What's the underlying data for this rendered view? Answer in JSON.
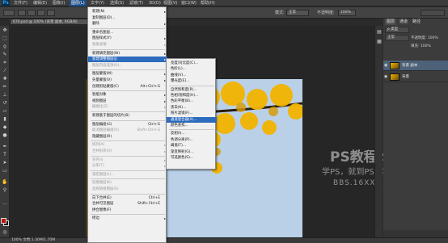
{
  "menubar": {
    "logo": "Ps",
    "items": [
      "文件(F)",
      "编辑(E)",
      "图像(I)",
      "图层(L)",
      "文字(Y)",
      "选择(S)",
      "滤镜(T)",
      "3D(D)",
      "视图(V)",
      "窗口(W)",
      "帮助(H)"
    ],
    "active_index": 3
  },
  "doc_tab": {
    "title": "670.psd @ 100% (背景 副本, RGB/8)"
  },
  "options": {
    "mode_label": "模式:",
    "mode_value": "正常",
    "opacity_label": "不透明度:",
    "opacity_value": "100%"
  },
  "status": {
    "text": "100%   文档:1.30M/1.70M"
  },
  "layer_menu": {
    "items": [
      {
        "label": "新建(N)",
        "arrow": true
      },
      {
        "label": "复制图层(D)...",
        "arrow": false
      },
      {
        "label": "删除",
        "arrow": true
      },
      {
        "sep": true
      },
      {
        "label": "重命名图层...",
        "arrow": false
      },
      {
        "label": "图层样式(Y)",
        "arrow": true
      },
      {
        "label": "智能滤镜",
        "arrow": true,
        "disabled": true
      },
      {
        "sep": true
      },
      {
        "label": "新建填充图层(W)",
        "arrow": true
      },
      {
        "label": "新建调整图层(J)",
        "arrow": true,
        "highlight": true
      },
      {
        "label": "图层内容选项(O)...",
        "disabled": true
      },
      {
        "sep": true
      },
      {
        "label": "图层蒙版(M)",
        "arrow": true
      },
      {
        "label": "矢量蒙版(V)",
        "arrow": true
      },
      {
        "label": "创建剪贴蒙版(C)",
        "shortcut": "Alt+Ctrl+G"
      },
      {
        "sep": true
      },
      {
        "label": "智能对象",
        "arrow": true
      },
      {
        "label": "视频图层",
        "arrow": true
      },
      {
        "label": "栅格化(Z)",
        "arrow": true,
        "disabled": true
      },
      {
        "sep": true
      },
      {
        "label": "新建基于图层的切片(B)"
      },
      {
        "sep": true
      },
      {
        "label": "图层编组(G)",
        "shortcut": "Ctrl+G"
      },
      {
        "label": "取消图层编组(U)",
        "shortcut": "Shift+Ctrl+G",
        "disabled": true
      },
      {
        "label": "隐藏图层(R)"
      },
      {
        "sep": true
      },
      {
        "label": "排列(A)",
        "arrow": true,
        "disabled": true
      },
      {
        "label": "合并形状(H)",
        "arrow": true,
        "disabled": true
      },
      {
        "sep": true
      },
      {
        "label": "对齐(I)",
        "arrow": true,
        "disabled": true
      },
      {
        "label": "分布(T)",
        "arrow": true,
        "disabled": true
      },
      {
        "sep": true
      },
      {
        "label": "锁定图层(L)...",
        "disabled": true
      },
      {
        "sep": true
      },
      {
        "label": "链接图层(K)",
        "disabled": true
      },
      {
        "label": "选择链接图层(S)",
        "disabled": true
      },
      {
        "sep": true
      },
      {
        "label": "向下合并(E)",
        "shortcut": "Ctrl+E"
      },
      {
        "label": "合并可见图层",
        "shortcut": "Shift+Ctrl+E"
      },
      {
        "label": "拼合图像(F)"
      },
      {
        "sep": true
      },
      {
        "label": "修边",
        "arrow": true
      }
    ]
  },
  "adjust_menu": {
    "items": [
      {
        "label": "亮度/对比度(C)..."
      },
      {
        "label": "色阶(L)..."
      },
      {
        "label": "曲线(V)..."
      },
      {
        "label": "曝光度(E)..."
      },
      {
        "sep": true
      },
      {
        "label": "自然饱和度(R)..."
      },
      {
        "label": "色相/饱和度(H)..."
      },
      {
        "label": "色彩平衡(B)..."
      },
      {
        "label": "黑白(K)..."
      },
      {
        "label": "照片滤镜(F)..."
      },
      {
        "label": "通道混合器(X)...",
        "highlight": true
      },
      {
        "label": "颜色查找..."
      },
      {
        "sep": true
      },
      {
        "label": "反相(I)..."
      },
      {
        "label": "色调分离(P)..."
      },
      {
        "label": "阈值(T)..."
      },
      {
        "label": "渐变映射(G)..."
      },
      {
        "label": "可选颜色(S)..."
      }
    ]
  },
  "panels": {
    "tabs": [
      "图层",
      "通道",
      "路径"
    ],
    "kind_label": "ρ 类型",
    "blend": "正常",
    "opacity": "不透明度: 100%",
    "fill": "填充: 100%",
    "layers": [
      {
        "name": "背景 副本",
        "selected": true
      },
      {
        "name": "背景",
        "selected": false
      }
    ]
  },
  "watermark": {
    "line1": "PS教程论坛",
    "line2": "学PS，就到PS教程论坛",
    "line3": "BBS.16XX8.COM"
  }
}
